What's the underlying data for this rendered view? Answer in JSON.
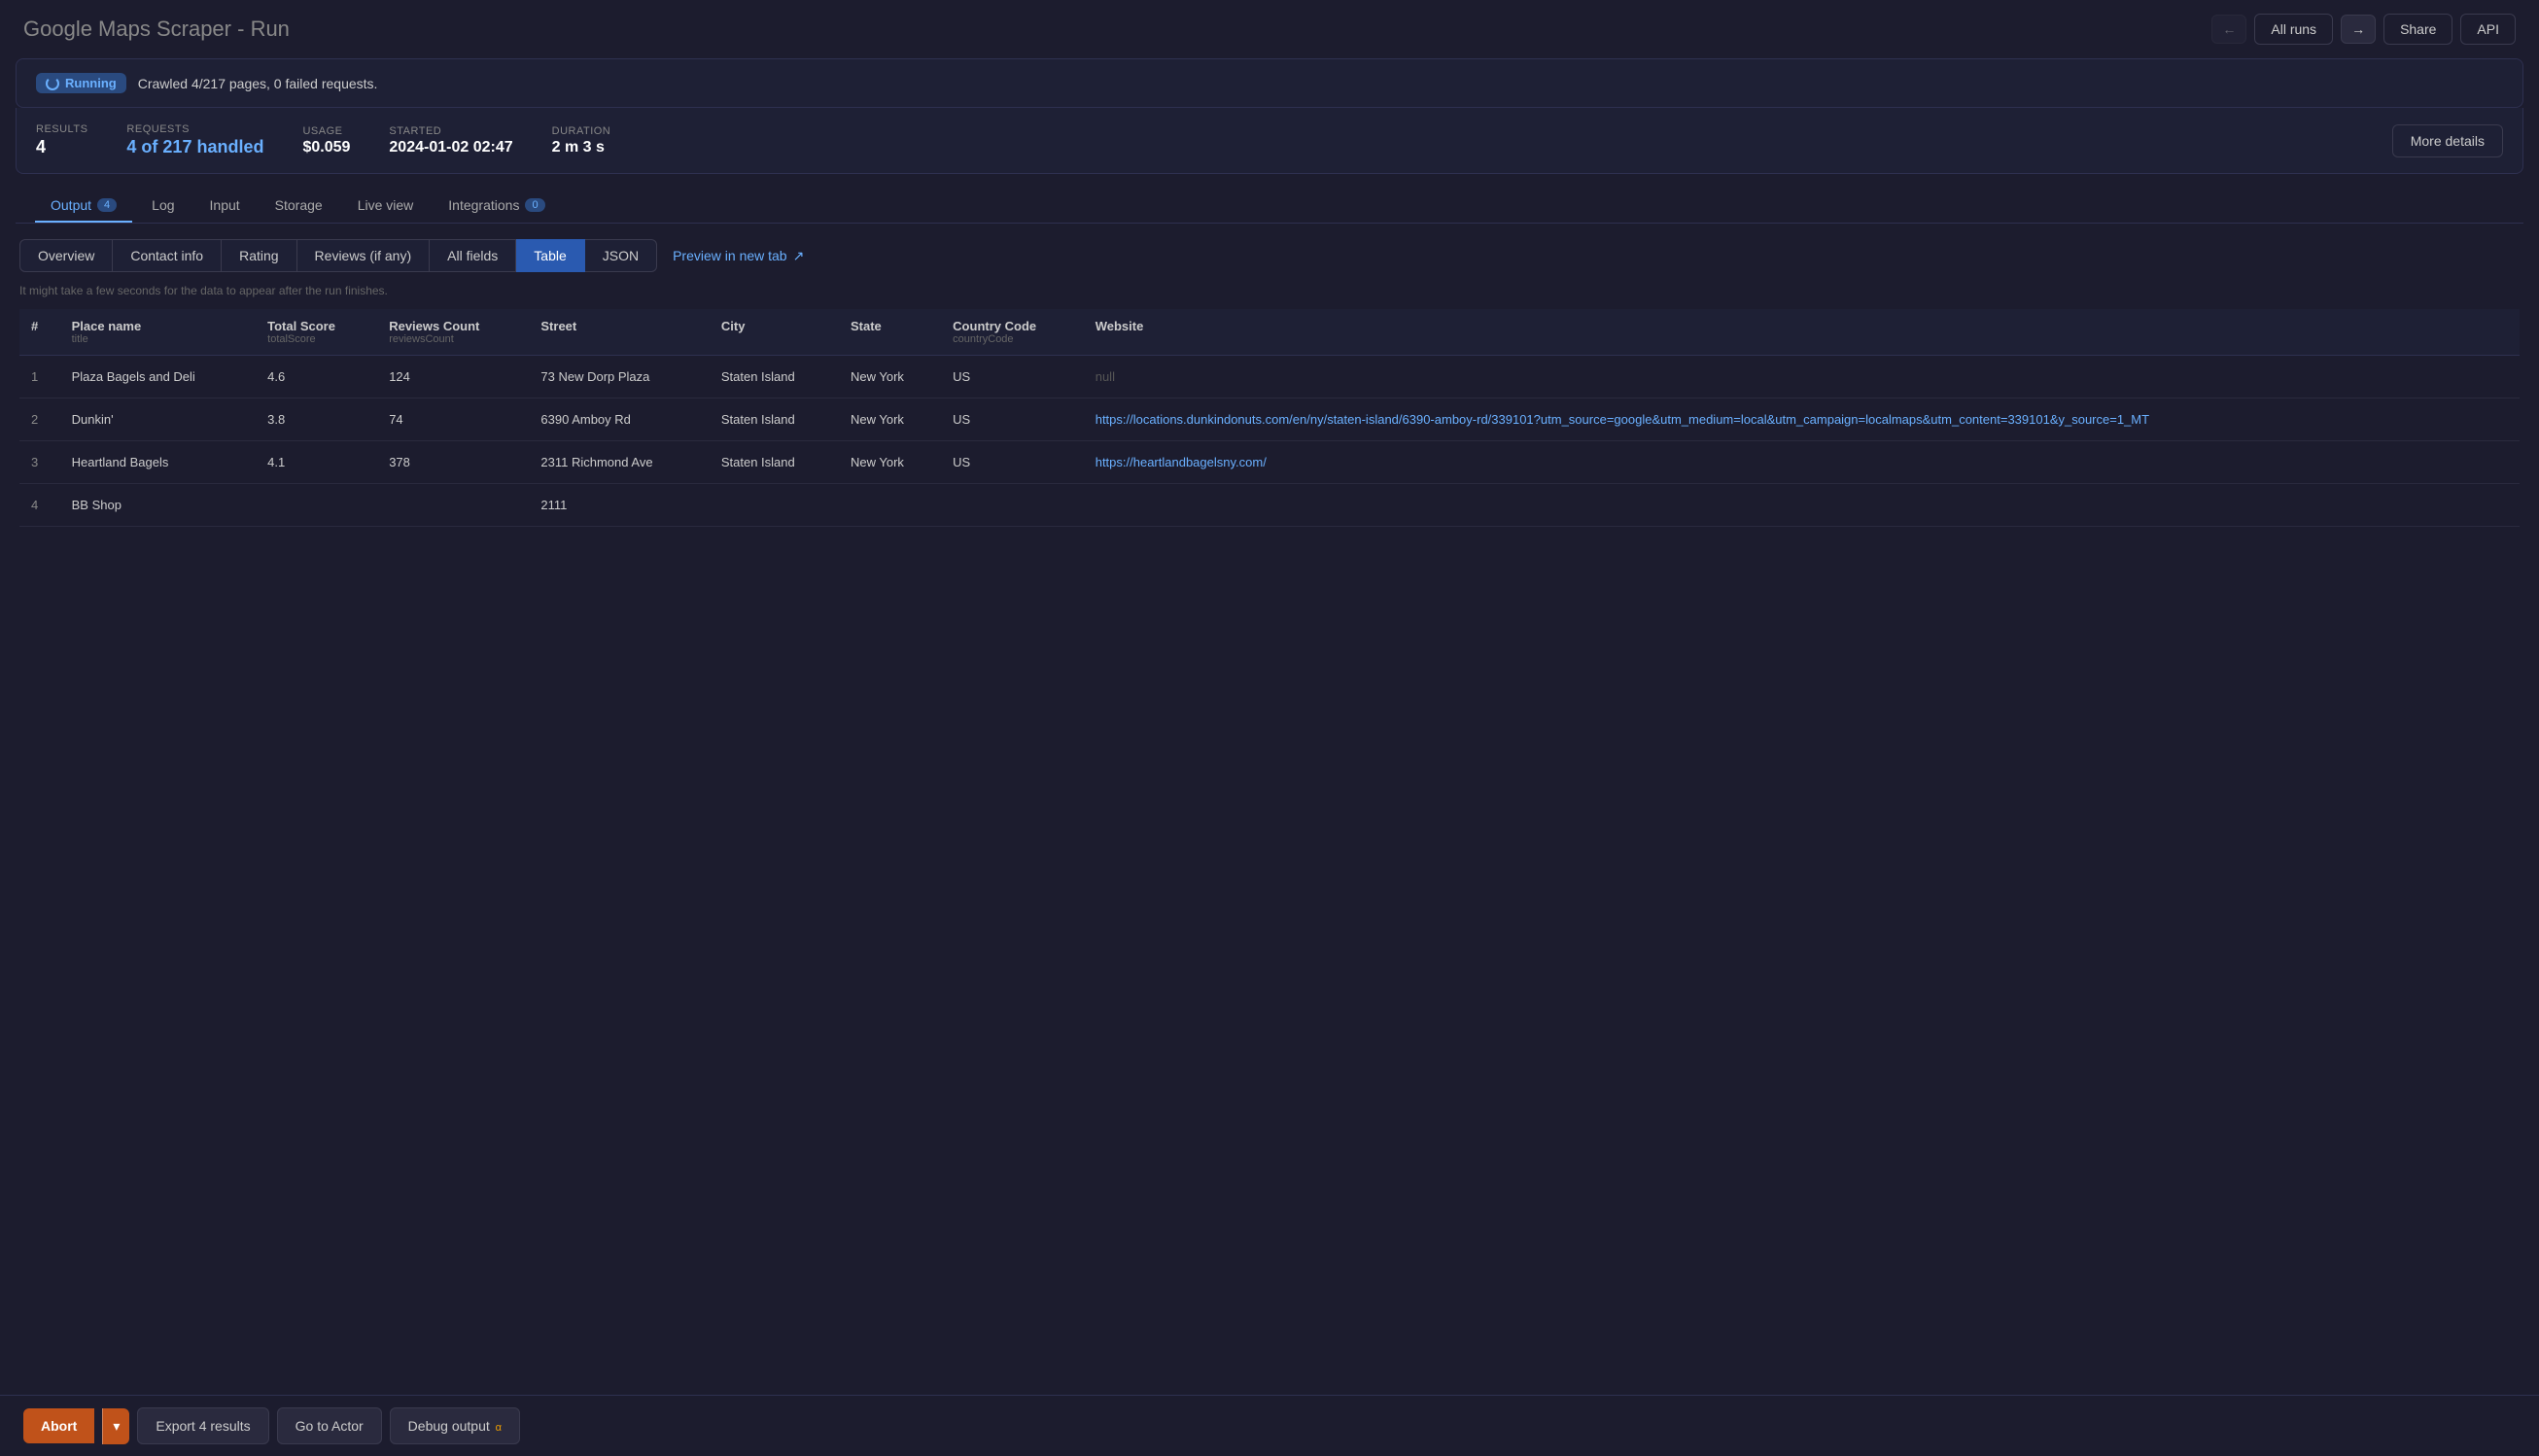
{
  "header": {
    "title": "Google Maps Scraper",
    "subtitle": "Run",
    "all_runs_label": "All runs",
    "share_label": "Share",
    "api_label": "API"
  },
  "banner": {
    "status": "Running",
    "message": "Crawled 4/217 pages, 0 failed requests."
  },
  "stats": {
    "results_label": "RESULTS",
    "results_value": "4",
    "requests_label": "REQUESTS",
    "requests_value": "4 of 217 handled",
    "usage_label": "USAGE",
    "usage_value": "$0.059",
    "started_label": "STARTED",
    "started_value": "2024-01-02 02:47",
    "duration_label": "DURATION",
    "duration_value": "2 m 3 s",
    "more_details": "More details"
  },
  "main_tabs": [
    {
      "label": "Output",
      "badge": "4",
      "active": true
    },
    {
      "label": "Log",
      "badge": null,
      "active": false
    },
    {
      "label": "Input",
      "badge": null,
      "active": false
    },
    {
      "label": "Storage",
      "badge": null,
      "active": false
    },
    {
      "label": "Live view",
      "badge": null,
      "active": false
    },
    {
      "label": "Integrations",
      "badge": "0",
      "active": false
    }
  ],
  "view_tabs": [
    {
      "label": "Overview",
      "active": false
    },
    {
      "label": "Contact info",
      "active": false
    },
    {
      "label": "Rating",
      "active": false
    },
    {
      "label": "Reviews (if any)",
      "active": false
    },
    {
      "label": "All fields",
      "active": false
    },
    {
      "label": "Table",
      "active": true
    },
    {
      "label": "JSON",
      "active": false
    }
  ],
  "preview_link": "Preview in new tab",
  "hint": "It might take a few seconds for the data to appear after the run finishes.",
  "table": {
    "columns": [
      {
        "label": "#",
        "sub": ""
      },
      {
        "label": "Place name",
        "sub": "title"
      },
      {
        "label": "Total Score",
        "sub": "totalScore"
      },
      {
        "label": "Reviews Count",
        "sub": "reviewsCount"
      },
      {
        "label": "Street",
        "sub": ""
      },
      {
        "label": "City",
        "sub": ""
      },
      {
        "label": "State",
        "sub": ""
      },
      {
        "label": "Country Code",
        "sub": "countryCode"
      },
      {
        "label": "Website",
        "sub": ""
      }
    ],
    "rows": [
      {
        "num": "1",
        "name": "Plaza Bagels and Deli",
        "score": "4.6",
        "reviews": "124",
        "street": "73 New Dorp Plaza",
        "city": "Staten Island",
        "state": "New York",
        "country": "US",
        "website": "null",
        "website_is_null": true,
        "website_is_link": false
      },
      {
        "num": "2",
        "name": "Dunkin'",
        "score": "3.8",
        "reviews": "74",
        "street": "6390 Amboy Rd",
        "city": "Staten Island",
        "state": "New York",
        "country": "US",
        "website": "https://locations.dunkindonuts.com/en/ny/staten-island/6390-amboy-rd/339101?utm_source=google&utm_medium=local&utm_campaign=localmaps&utm_content=339101&y_source=1_MT",
        "website_is_null": false,
        "website_is_link": true
      },
      {
        "num": "3",
        "name": "Heartland Bagels",
        "score": "4.1",
        "reviews": "378",
        "street": "2311 Richmond Ave",
        "city": "Staten Island",
        "state": "New York",
        "country": "US",
        "website": "https://heartlandbagelsny.com/",
        "website_is_null": false,
        "website_is_link": true
      },
      {
        "num": "4",
        "name": "BB Shop",
        "score": "",
        "reviews": "",
        "street": "2111",
        "city": "",
        "state": "",
        "country": "",
        "website": "",
        "website_is_null": false,
        "website_is_link": false
      }
    ]
  },
  "bottom_bar": {
    "abort": "Abort",
    "export": "Export 4 results",
    "go_to_actor": "Go to Actor",
    "debug": "Debug output",
    "alpha": "α"
  }
}
